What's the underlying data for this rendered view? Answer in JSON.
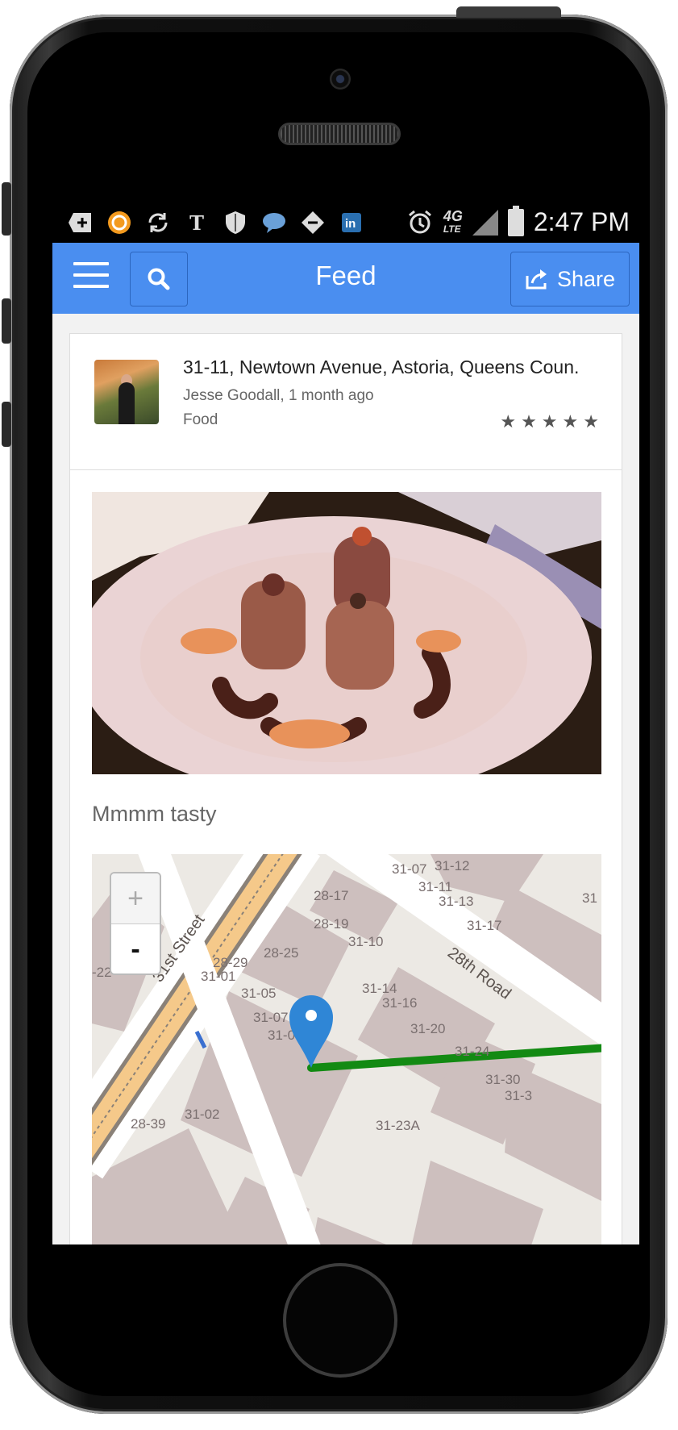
{
  "status_bar": {
    "time": "2:47 PM",
    "network": "4G",
    "network_sub": "LTE",
    "icons": [
      "add-box-icon",
      "orange-circle-app-icon",
      "sync-icon",
      "nyt-icon",
      "shield-icon",
      "chat-icon",
      "ticket-icon",
      "linkedin-icon",
      "alarm-icon"
    ]
  },
  "appbar": {
    "title": "Feed",
    "share_label": "Share",
    "color": "#4a8ef0"
  },
  "post": {
    "place": "31-11, Newtown Avenue, Astoria, Queens Coun.",
    "author_time": "Jesse Goodall, 1 month ago",
    "category": "Food",
    "rating_stars": 5,
    "stars": [
      "★",
      "★",
      "★",
      "★",
      "★"
    ],
    "caption": "Mmmm tasty"
  },
  "map": {
    "zoom_in": "+",
    "zoom_out": "-",
    "street_labels": [
      "31st Street",
      "28th Road"
    ],
    "lot_labels": [
      "31-07",
      "31-12",
      "31-11",
      "31-13",
      "31-17",
      "28-17",
      "28-19",
      "31-10",
      "28-29",
      "28-25",
      "31-01",
      "31-05",
      "31-14",
      "31-16",
      "31-07",
      "31-0",
      "31-20",
      "31-24",
      "31-30",
      "31-3",
      "28-39",
      "31-02",
      "31-23A",
      "-22",
      "31"
    ]
  }
}
